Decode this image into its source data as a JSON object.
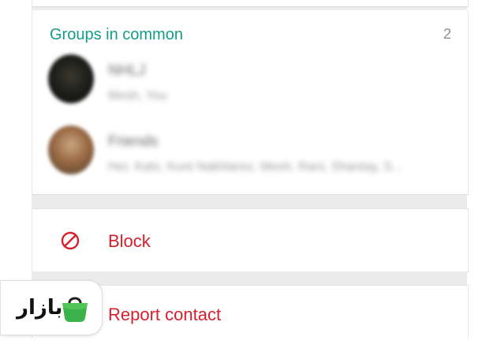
{
  "groups_section": {
    "title": "Groups in common",
    "count": "2",
    "items": [
      {
        "name": "NHLJ",
        "members": "Mesh, You"
      },
      {
        "name": "Friends",
        "members": "Her, Kalo, Kunt Nakhlarez, Mesh, Rani, Shantay, S..."
      }
    ]
  },
  "actions": {
    "block_label": "Block",
    "report_label": "Report contact"
  },
  "badge": {
    "text": "بازار"
  },
  "colors": {
    "accent": "#139c88",
    "danger": "#d3202d",
    "badge_green": "#3bb34a"
  },
  "icons": {
    "block": "block-icon",
    "report": "report-icon",
    "bag": "shopping-bag-icon"
  }
}
